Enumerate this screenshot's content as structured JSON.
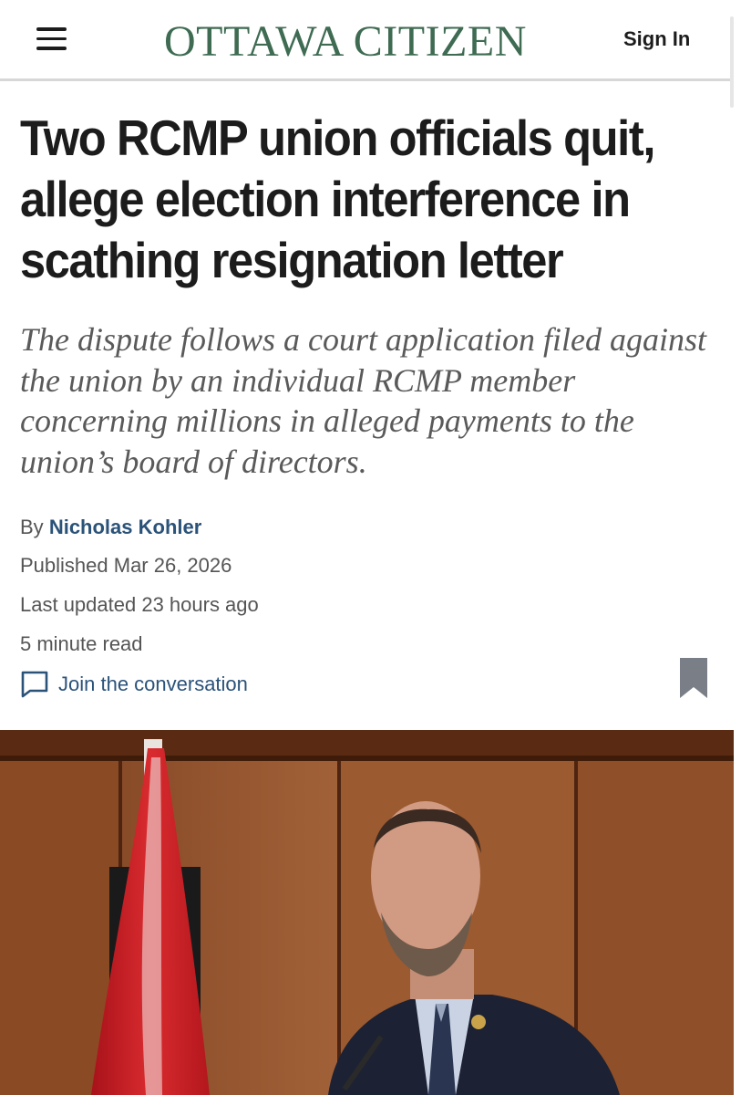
{
  "header": {
    "logo": "OTTAWA CITIZEN",
    "sign_in": "Sign In"
  },
  "article": {
    "headline": "Two RCMP union officials quit, allege election interference in scathing resignation letter",
    "dek": "The dispute follows a court application filed against the union by an individual RCMP member concerning millions in alleged payments to the union’s board of directors.",
    "by_prefix": "By",
    "author": "Nicholas Kohler",
    "published": "Published Mar 26, 2026",
    "updated": "Last updated 23 hours ago",
    "read_time": "5 minute read",
    "join_label": "Join the conversation"
  },
  "icons": {
    "menu": "hamburger-menu-icon",
    "comment": "speech-bubble-icon",
    "bookmark": "bookmark-icon"
  },
  "colors": {
    "brand": "#3e6b52",
    "link": "#2b5279",
    "headline": "#1c1c1c",
    "dek": "#5a5a5a",
    "meta": "#555555",
    "bookmark": "#7a7f87"
  }
}
